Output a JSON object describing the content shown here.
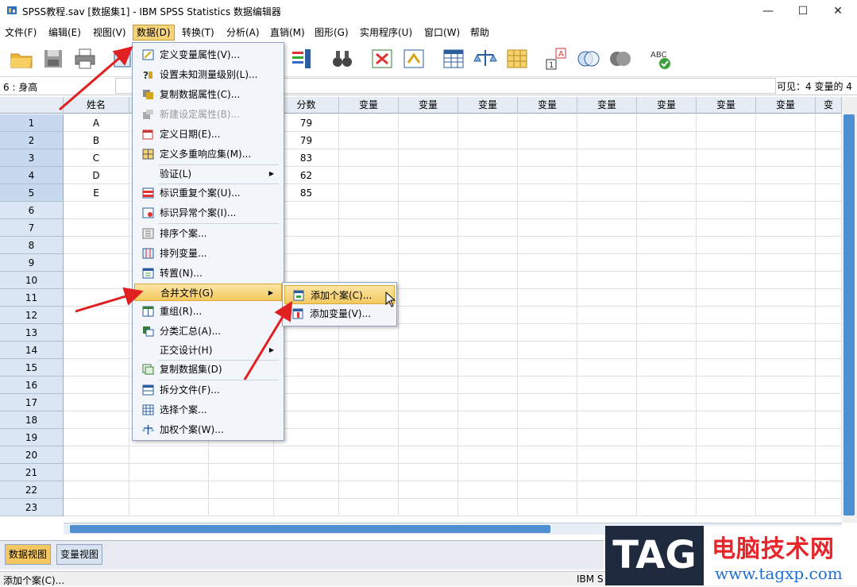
{
  "window": {
    "title": "SPSS教程.sav [数据集1] - IBM SPSS Statistics 数据编辑器",
    "minimize": "—",
    "maximize": "☐",
    "close": "✕"
  },
  "menubar": [
    {
      "label": "文件(F)"
    },
    {
      "label": "编辑(E)"
    },
    {
      "label": "视图(V)"
    },
    {
      "label": "数据(D)"
    },
    {
      "label": "转换(T)"
    },
    {
      "label": "分析(A)"
    },
    {
      "label": "直销(M)"
    },
    {
      "label": "图形(G)"
    },
    {
      "label": "实用程序(U)"
    },
    {
      "label": "窗口(W)"
    },
    {
      "label": "帮助"
    }
  ],
  "editline": {
    "cell_ref": "6 : 身高",
    "cell_value": "",
    "visible_info": "可见：4 变量的 4"
  },
  "grid": {
    "columns": [
      "姓名",
      "",
      "",
      "分数",
      "变量",
      "变量",
      "变量",
      "变量",
      "变量",
      "变量",
      "变量",
      "变量",
      "变"
    ],
    "rows": [
      "1",
      "2",
      "3",
      "4",
      "5",
      "6",
      "7",
      "8",
      "9",
      "10",
      "11",
      "12",
      "13",
      "14",
      "15",
      "16",
      "17",
      "18",
      "19",
      "20",
      "21",
      "22",
      "23"
    ],
    "names": [
      "A",
      "B",
      "C",
      "D",
      "E"
    ],
    "scores": [
      "79",
      "79",
      "83",
      "62",
      "85"
    ]
  },
  "data_menu": {
    "items": [
      {
        "label": "定义变量属性(V)...",
        "icon": "define-variable-properties-icon"
      },
      {
        "label": "设置未知测量级别(L)...",
        "icon": "unknown-measurement-icon"
      },
      {
        "label": "复制数据属性(C)...",
        "icon": "copy-data-properties-icon"
      },
      {
        "label": "新建设定属性(B)...",
        "icon": "new-custom-attribute-icon",
        "disabled": true
      },
      {
        "label": "定义日期(E)...",
        "icon": "calendar-icon"
      },
      {
        "label": "定义多重响应集(M)...",
        "icon": "multiple-response-icon"
      },
      {
        "label": "验证(L)",
        "submenu": true
      },
      {
        "label": "标识重复个案(U)...",
        "icon": "duplicate-cases-icon"
      },
      {
        "label": "标识异常个案(I)...",
        "icon": "unusual-cases-icon"
      },
      {
        "label": "排序个案...",
        "icon": "sort-cases-icon"
      },
      {
        "label": "排列变量...",
        "icon": "sort-variables-icon"
      },
      {
        "label": "转置(N)...",
        "icon": "transpose-icon"
      },
      {
        "label": "合并文件(G)",
        "submenu": true,
        "highlighted": true
      },
      {
        "label": "重组(R)...",
        "icon": "restructure-icon"
      },
      {
        "label": "分类汇总(A)...",
        "icon": "aggregate-icon"
      },
      {
        "label": "正交设计(H)",
        "submenu": true
      },
      {
        "label": "复制数据集(D)",
        "icon": "copy-dataset-icon"
      },
      {
        "label": "拆分文件(F)...",
        "icon": "split-file-icon"
      },
      {
        "label": "选择个案...",
        "icon": "select-cases-icon"
      },
      {
        "label": "加权个案(W)...",
        "icon": "weight-cases-icon"
      }
    ]
  },
  "merge_submenu": {
    "items": [
      {
        "label": "添加个案(C)...",
        "icon": "add-cases-icon"
      },
      {
        "label": "添加变量(V)...",
        "icon": "add-variables-icon"
      }
    ]
  },
  "tabs": {
    "data_view": "数据视图",
    "variable_view": "变量视图"
  },
  "status": {
    "text": "添加个案(C)...",
    "ibm": "IBM S"
  },
  "watermark": {
    "logo": "TAG",
    "title": "电脑技术网",
    "url": "www.tagxp.com"
  },
  "colors": {
    "accent": "#f4c860",
    "selection_blue": "#4d8fd1",
    "arrow_red": "#e02020"
  }
}
